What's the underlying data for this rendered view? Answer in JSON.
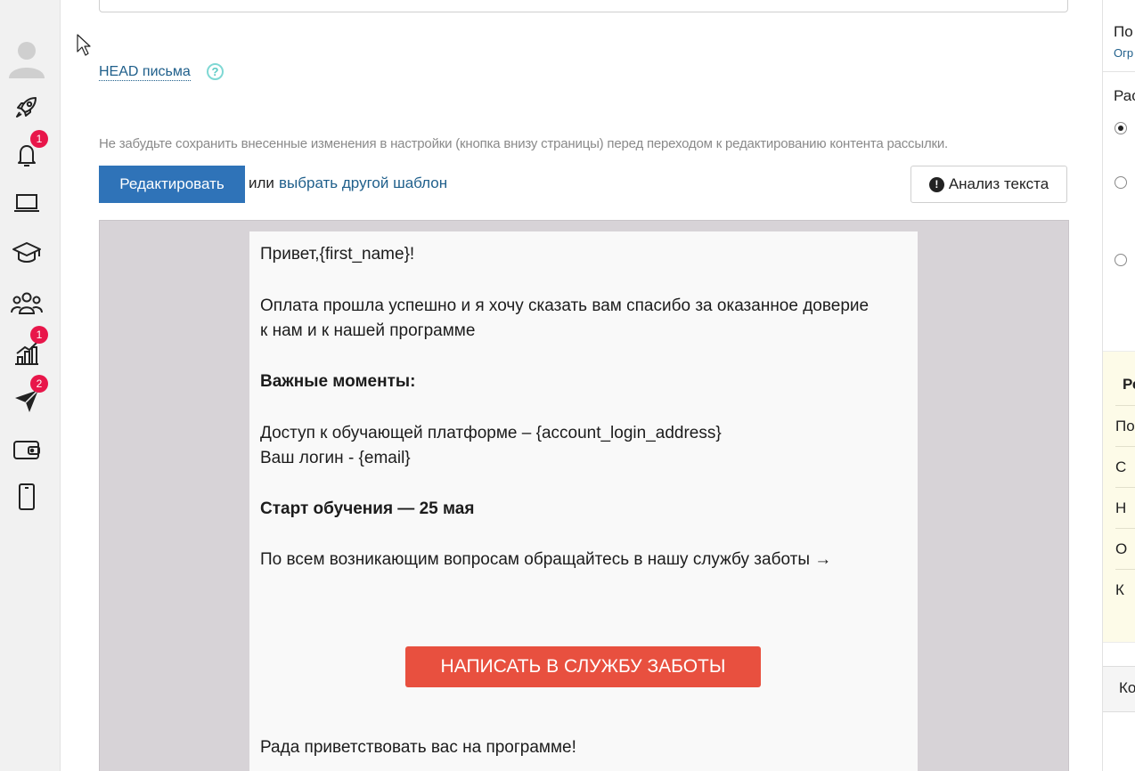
{
  "sidebar": {
    "items": [
      {
        "name": "avatar",
        "icon": "user-avatar-icon"
      },
      {
        "name": "rocket",
        "icon": "rocket-icon"
      },
      {
        "name": "notifications",
        "icon": "bell-icon",
        "badge": "1"
      },
      {
        "name": "laptop",
        "icon": "laptop-icon"
      },
      {
        "name": "education",
        "icon": "graduation-cap-icon"
      },
      {
        "name": "users",
        "icon": "users-icon"
      },
      {
        "name": "analytics",
        "icon": "chart-bars-icon",
        "badge": "1"
      },
      {
        "name": "mailings",
        "icon": "paper-plane-icon",
        "badge": "2"
      },
      {
        "name": "wallet",
        "icon": "wallet-icon"
      },
      {
        "name": "mobile",
        "icon": "mobile-icon"
      }
    ],
    "badge_color": "#e8164a"
  },
  "editor": {
    "head_link": "HEAD письма",
    "help": "?",
    "notice": "Не забудьте сохранить внесенные изменения в настройки (кнопка внизу страницы) перед переходом к редактированию контента рассылки.",
    "edit_button": "Редактировать",
    "or": "или",
    "choose_template": "выбрать другой шаблон",
    "analyze_button": "Анализ текста",
    "analyze_icon": "!"
  },
  "email": {
    "greeting": "Привет,{first_name}!",
    "paragraph1_line1": "Оплата прошла успешно и я хочу сказать вам спасибо за оказанное доверие",
    "paragraph1_line2": "к нам и к нашей программе",
    "important_heading": "Важные моменты:",
    "access_line": "Доступ к обучающей платформе – {account_login_address}",
    "login_line": "Ваш логин - {email}",
    "start_line": "Старт обучения — 25 мая",
    "questions_line": "По всем возникающим вопросам обращайтесь в нашу службу заботы →",
    "cta_button": "НАПИСАТЬ В СЛУЖБУ ЗАБОТЫ",
    "closing_line": "Рада приветствовать вас на программе!",
    "cta_color": "#e8503f"
  },
  "right_panel": {
    "title_fragment": "По",
    "link_fragment": "Огр",
    "section_fragment": "Рас",
    "box_title_fragment": "Ре",
    "box_rows": [
      "По",
      "С",
      "Н",
      "О",
      "К"
    ],
    "bottom_fragment": "Ко"
  },
  "colors": {
    "primary_button": "#2f73b8",
    "link": "#1f5f8b",
    "preview_background": "#d7d3d7"
  }
}
